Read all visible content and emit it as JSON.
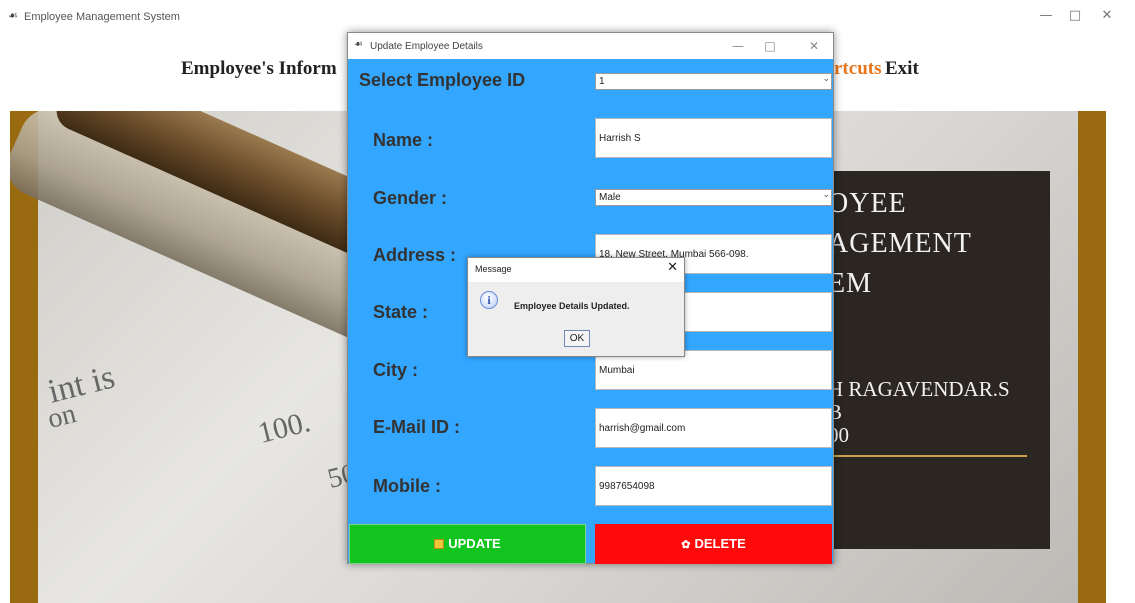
{
  "main_window": {
    "title": "Employee Management System",
    "controls": {
      "minimize": "—",
      "maximize": "□",
      "close": "✕"
    }
  },
  "menu": {
    "info_partial": "Employee's Inform",
    "shortcuts_partial": "rtcuts",
    "exit": "Exit"
  },
  "background_board": {
    "heading_lines": [
      "OYEE",
      "AGEMENT",
      "EM"
    ],
    "detail_lines": [
      "H RAGAVENDAR.S",
      "B",
      "00"
    ]
  },
  "background_photo_text": {
    "line1": "int is",
    "line2": "on",
    "number1": "100.",
    "number2": "50"
  },
  "dialog": {
    "title": "Update Employee Details",
    "controls": {
      "minimize": "—",
      "maximize": "□",
      "close": "✕"
    },
    "fields": {
      "employee_id": {
        "label": "Select Employee ID",
        "value": "1"
      },
      "name": {
        "label": "Name  :",
        "value": "Harrish S"
      },
      "gender": {
        "label": "Gender  :",
        "value": "Male"
      },
      "address": {
        "label": "Address  :",
        "value": "18, New Street, Mumbai 566-098."
      },
      "state": {
        "label": "State  :",
        "value": ""
      },
      "city": {
        "label": "City  :",
        "value": "Mumbai"
      },
      "email": {
        "label": "E-Mail ID  :",
        "value": "harrish@gmail.com"
      },
      "mobile": {
        "label": "Mobile  :",
        "value": "9987654098"
      }
    },
    "buttons": {
      "update": "UPDATE",
      "delete": "DELETE"
    },
    "colors": {
      "background": "#33a6ff",
      "update": "#11c41e",
      "delete": "#ff0a0a"
    }
  },
  "message_box": {
    "title": "Message",
    "icon": "info-icon",
    "icon_glyph": "i",
    "text": "Employee Details Updated.",
    "ok": "OK",
    "close": "✕"
  }
}
